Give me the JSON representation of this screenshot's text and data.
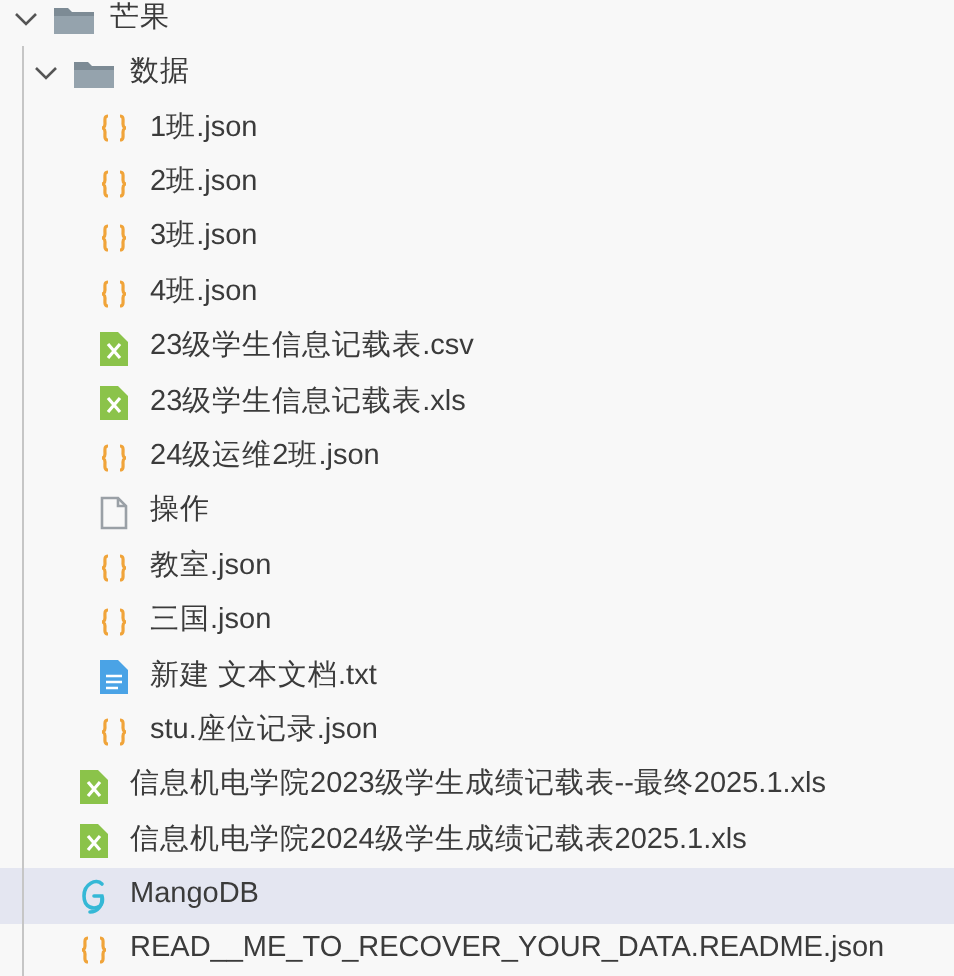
{
  "tree": [
    {
      "label": "芒果",
      "kind": "folder",
      "expanded": true,
      "selected": false,
      "children": [
        {
          "label": "数据",
          "kind": "folder",
          "expanded": true,
          "selected": false,
          "children": [
            {
              "label": "1班.json",
              "kind": "json",
              "selected": false
            },
            {
              "label": "2班.json",
              "kind": "json",
              "selected": false
            },
            {
              "label": "3班.json",
              "kind": "json",
              "selected": false
            },
            {
              "label": "4班.json",
              "kind": "json",
              "selected": false
            },
            {
              "label": "23级学生信息记载表.csv",
              "kind": "sheet",
              "selected": false
            },
            {
              "label": "23级学生信息记载表.xls",
              "kind": "sheet",
              "selected": false
            },
            {
              "label": "24级运维2班.json",
              "kind": "json",
              "selected": false
            },
            {
              "label": "操作",
              "kind": "file",
              "selected": false
            },
            {
              "label": "教室.json",
              "kind": "json",
              "selected": false
            },
            {
              "label": "三国.json",
              "kind": "json",
              "selected": false
            },
            {
              "label": "新建 文本文档.txt",
              "kind": "text",
              "selected": false
            },
            {
              "label": "stu.座位记录.json",
              "kind": "json",
              "selected": false
            }
          ]
        },
        {
          "label": "信息机电学院2023级学生成绩记载表--最终2025.1.xls",
          "kind": "sheet",
          "selected": false
        },
        {
          "label": "信息机电学院2024级学生成绩记载表2025.1.xls",
          "kind": "sheet",
          "selected": false
        },
        {
          "label": "MangoDB",
          "kind": "script",
          "selected": true
        },
        {
          "label": "READ__ME_TO_RECOVER_YOUR_DATA.README.json",
          "kind": "json",
          "selected": false
        }
      ]
    }
  ]
}
